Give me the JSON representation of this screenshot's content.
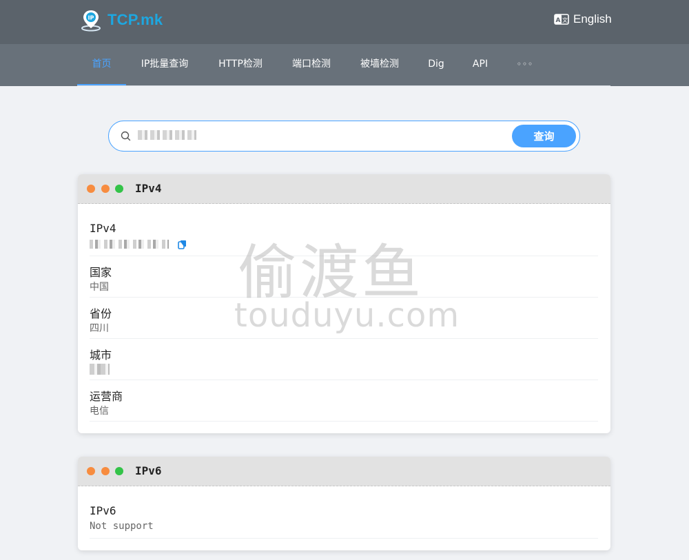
{
  "header": {
    "logo_text": "TCP.mk",
    "language_label": "English"
  },
  "nav": {
    "items": [
      {
        "label": "首页",
        "active": true
      },
      {
        "label": "IP批量查询",
        "active": false
      },
      {
        "label": "HTTP检测",
        "active": false
      },
      {
        "label": "端口检测",
        "active": false
      },
      {
        "label": "被墙检测",
        "active": false
      },
      {
        "label": "Dig",
        "active": false
      },
      {
        "label": "API",
        "active": false
      }
    ],
    "more_label": "◦◦◦"
  },
  "search": {
    "placeholder": "",
    "button_label": "查询"
  },
  "ipv4_card": {
    "title": "IPv4",
    "rows": [
      {
        "label": "IPv4",
        "value": ""
      },
      {
        "label": "国家",
        "value": "中国"
      },
      {
        "label": "省份",
        "value": "四川"
      },
      {
        "label": "城市",
        "value": ""
      },
      {
        "label": "运营商",
        "value": "电信"
      }
    ]
  },
  "ipv6_card": {
    "title": "IPv6",
    "rows": [
      {
        "label": "IPv6",
        "value": "Not support"
      }
    ]
  },
  "watermark": {
    "chinese": "偷渡鱼",
    "latin": "touduyu.com"
  },
  "colors": {
    "accent": "#4aa3ff",
    "header_bg": "#5b636b",
    "nav_bg": "#68717a",
    "logo": "#1da7e0"
  }
}
